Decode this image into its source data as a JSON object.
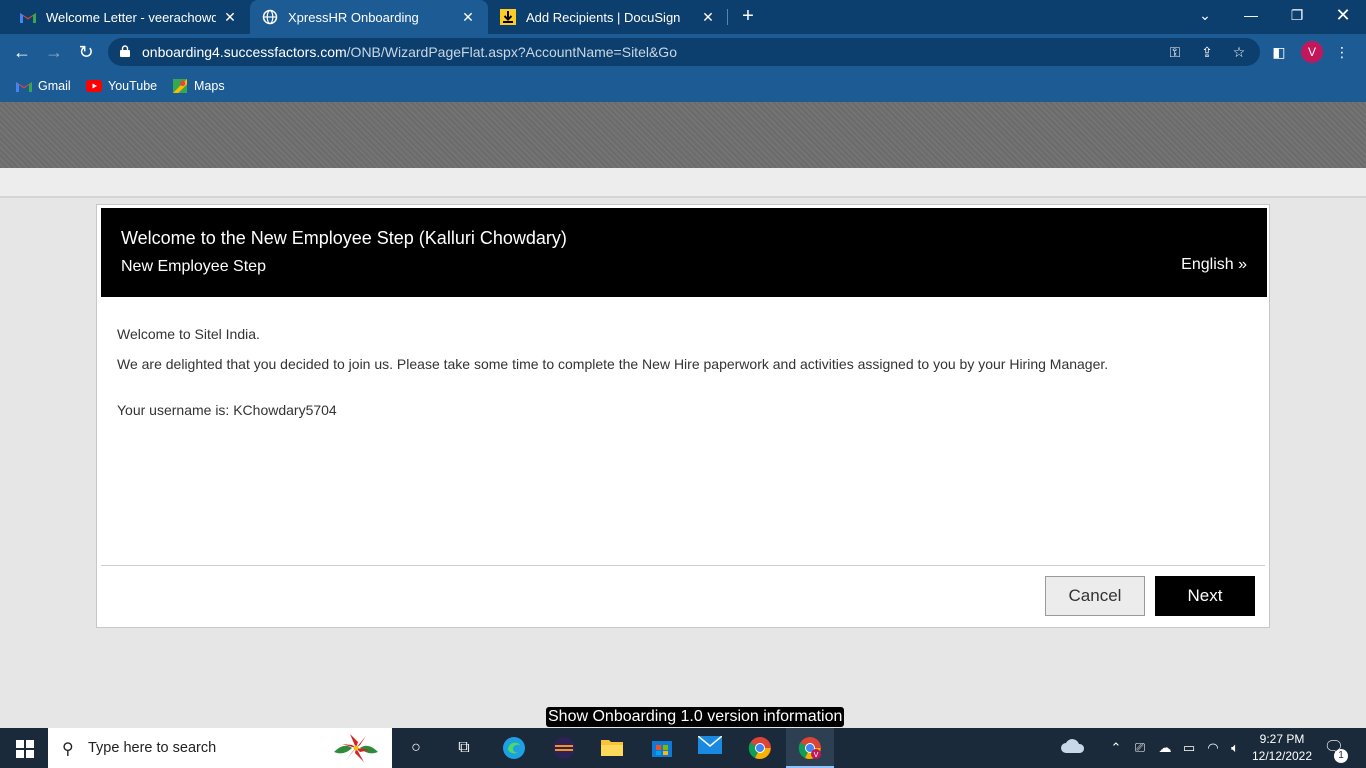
{
  "browser": {
    "tabs": [
      {
        "label": "Welcome Letter - veerachowdary",
        "icon": "gmail-icon",
        "active": false
      },
      {
        "label": "XpressHR Onboarding",
        "icon": "globe-icon",
        "active": true
      },
      {
        "label": "Add Recipients | DocuSign",
        "icon": "docusign-icon",
        "active": false
      }
    ],
    "url_host": "onboarding4.successfactors.com",
    "url_path": "/ONB/WizardPageFlat.aspx?AccountName=Sitel&Go",
    "profile_initial": "V",
    "bookmarks": [
      {
        "label": "Gmail"
      },
      {
        "label": "YouTube"
      },
      {
        "label": "Maps"
      }
    ]
  },
  "page": {
    "banner_title": "Welcome to the New Employee Step (Kalluri Chowdary)",
    "banner_subtitle": "New Employee Step",
    "language": "English »",
    "welcome": "Welcome to Sitel India.",
    "message": "We are delighted that you decided to join us. Please take some time to complete the New Hire paperwork and activities assigned to you by your Hiring Manager.",
    "username_line": "Your username is: KChowdary5704",
    "cancel_label": "Cancel",
    "next_label": "Next",
    "version_info": "Show Onboarding 1.0 version information"
  },
  "taskbar": {
    "search_placeholder": "Type here to search",
    "time": "9:27 PM",
    "date": "12/12/2022",
    "notification_count": "1"
  },
  "colors": {
    "chrome_frame": "#0d3f6e",
    "chrome_toolbar": "#1d5b94",
    "banner": "#000000",
    "taskbar": "#1b2a3a"
  }
}
